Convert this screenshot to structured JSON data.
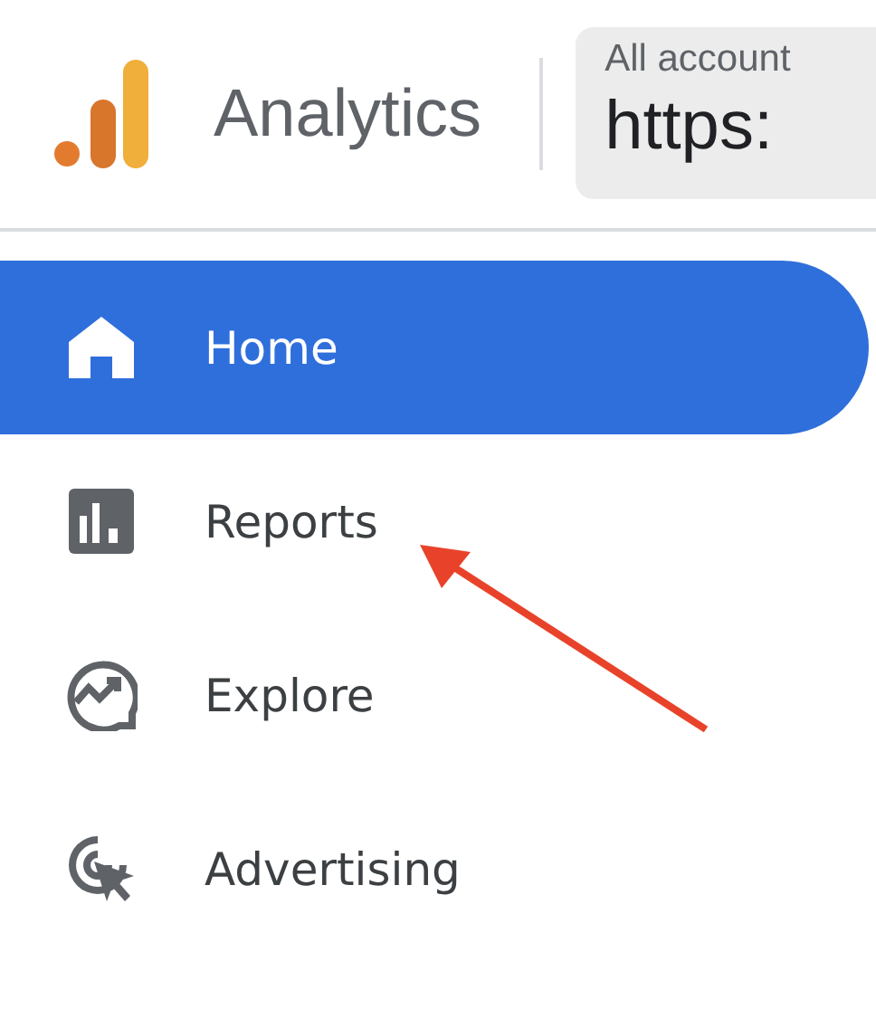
{
  "header": {
    "product": "Analytics",
    "account_label": "All account",
    "property": "https:"
  },
  "nav": [
    {
      "label": "Home",
      "kind": "home",
      "selected": true
    },
    {
      "label": "Reports",
      "kind": "reports",
      "selected": false
    },
    {
      "label": "Explore",
      "kind": "explore",
      "selected": false
    },
    {
      "label": "Advertising",
      "kind": "advertising",
      "selected": false
    }
  ]
}
